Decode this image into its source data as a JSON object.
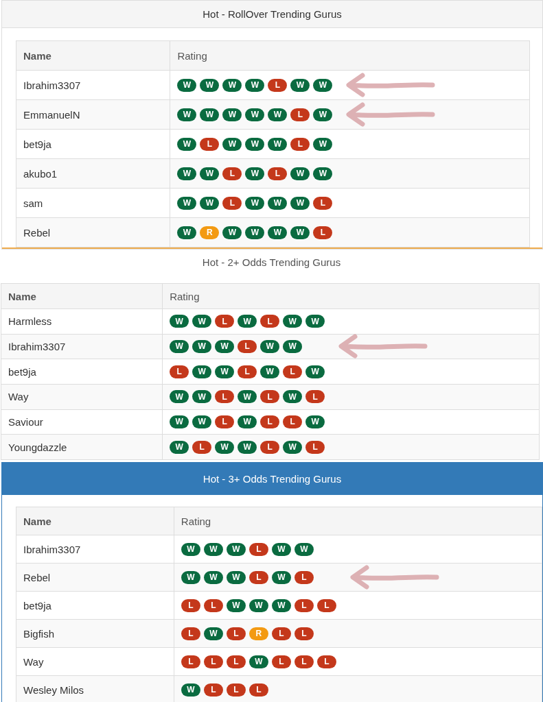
{
  "panels": [
    {
      "kind": "grey",
      "title": "Hot - RollOver Trending Gurus",
      "columns": [
        "Name",
        "Rating"
      ],
      "rows": [
        {
          "name": "Ibrahim3307",
          "annotated": true,
          "badges": [
            {
              "text": "W",
              "color": "#0a6b40"
            },
            {
              "text": "W",
              "color": "#0a6b40"
            },
            {
              "text": "W",
              "color": "#0a6b40"
            },
            {
              "text": "W",
              "color": "#0a6b40"
            },
            {
              "text": "L",
              "color": "#c4381b"
            },
            {
              "text": "W",
              "color": "#0a6b40"
            },
            {
              "text": "W",
              "color": "#0a6b40"
            }
          ]
        },
        {
          "name": "EmmanuelN",
          "annotated": true,
          "badges": [
            {
              "text": "W",
              "color": "#0a6b40"
            },
            {
              "text": "W",
              "color": "#0a6b40"
            },
            {
              "text": "W",
              "color": "#0a6b40"
            },
            {
              "text": "W",
              "color": "#0a6b40"
            },
            {
              "text": "W",
              "color": "#0a6b40"
            },
            {
              "text": "L",
              "color": "#c4381b"
            },
            {
              "text": "W",
              "color": "#0a6b40"
            }
          ]
        },
        {
          "name": "bet9ja",
          "annotated": false,
          "badges": [
            {
              "text": "W",
              "color": "#0a6b40"
            },
            {
              "text": "L",
              "color": "#c4381b"
            },
            {
              "text": "W",
              "color": "#0a6b40"
            },
            {
              "text": "W",
              "color": "#0a6b40"
            },
            {
              "text": "W",
              "color": "#0a6b40"
            },
            {
              "text": "L",
              "color": "#c4381b"
            },
            {
              "text": "W",
              "color": "#0a6b40"
            }
          ]
        },
        {
          "name": "akubo1",
          "annotated": false,
          "badges": [
            {
              "text": "W",
              "color": "#0a6b40"
            },
            {
              "text": "W",
              "color": "#0a6b40"
            },
            {
              "text": "L",
              "color": "#c4381b"
            },
            {
              "text": "W",
              "color": "#0a6b40"
            },
            {
              "text": "L",
              "color": "#c4381b"
            },
            {
              "text": "W",
              "color": "#0a6b40"
            },
            {
              "text": "W",
              "color": "#0a6b40"
            }
          ]
        },
        {
          "name": "sam",
          "annotated": false,
          "badges": [
            {
              "text": "W",
              "color": "#0a6b40"
            },
            {
              "text": "W",
              "color": "#0a6b40"
            },
            {
              "text": "L",
              "color": "#c4381b"
            },
            {
              "text": "W",
              "color": "#0a6b40"
            },
            {
              "text": "W",
              "color": "#0a6b40"
            },
            {
              "text": "W",
              "color": "#0a6b40"
            },
            {
              "text": "L",
              "color": "#c4381b"
            }
          ]
        },
        {
          "name": "Rebel",
          "annotated": false,
          "badges": [
            {
              "text": "W",
              "color": "#0a6b40"
            },
            {
              "text": "R",
              "color": "#f39a12"
            },
            {
              "text": "W",
              "color": "#0a6b40"
            },
            {
              "text": "W",
              "color": "#0a6b40"
            },
            {
              "text": "W",
              "color": "#0a6b40"
            },
            {
              "text": "W",
              "color": "#0a6b40"
            },
            {
              "text": "L",
              "color": "#c4381b"
            }
          ]
        }
      ]
    },
    {
      "kind": "plain",
      "title": "Hot - 2+ Odds Trending Gurus",
      "columns": [
        "Name",
        "Rating"
      ],
      "rows": [
        {
          "name": "Harmless",
          "annotated": false,
          "badges": [
            {
              "text": "W",
              "color": "#0a6b40"
            },
            {
              "text": "W",
              "color": "#0a6b40"
            },
            {
              "text": "L",
              "color": "#c4381b"
            },
            {
              "text": "W",
              "color": "#0a6b40"
            },
            {
              "text": "L",
              "color": "#c4381b"
            },
            {
              "text": "W",
              "color": "#0a6b40"
            },
            {
              "text": "W",
              "color": "#0a6b40"
            }
          ]
        },
        {
          "name": "Ibrahim3307",
          "annotated": true,
          "badges": [
            {
              "text": "W",
              "color": "#0a6b40"
            },
            {
              "text": "W",
              "color": "#0a6b40"
            },
            {
              "text": "W",
              "color": "#0a6b40"
            },
            {
              "text": "L",
              "color": "#c4381b"
            },
            {
              "text": "W",
              "color": "#0a6b40"
            },
            {
              "text": "W",
              "color": "#0a6b40"
            }
          ]
        },
        {
          "name": "bet9ja",
          "annotated": false,
          "badges": [
            {
              "text": "L",
              "color": "#c4381b"
            },
            {
              "text": "W",
              "color": "#0a6b40"
            },
            {
              "text": "W",
              "color": "#0a6b40"
            },
            {
              "text": "L",
              "color": "#c4381b"
            },
            {
              "text": "W",
              "color": "#0a6b40"
            },
            {
              "text": "L",
              "color": "#c4381b"
            },
            {
              "text": "W",
              "color": "#0a6b40"
            }
          ]
        },
        {
          "name": "Way",
          "annotated": false,
          "badges": [
            {
              "text": "W",
              "color": "#0a6b40"
            },
            {
              "text": "W",
              "color": "#0a6b40"
            },
            {
              "text": "L",
              "color": "#c4381b"
            },
            {
              "text": "W",
              "color": "#0a6b40"
            },
            {
              "text": "L",
              "color": "#c4381b"
            },
            {
              "text": "W",
              "color": "#0a6b40"
            },
            {
              "text": "L",
              "color": "#c4381b"
            }
          ]
        },
        {
          "name": "Saviour",
          "annotated": false,
          "badges": [
            {
              "text": "W",
              "color": "#0a6b40"
            },
            {
              "text": "W",
              "color": "#0a6b40"
            },
            {
              "text": "L",
              "color": "#c4381b"
            },
            {
              "text": "W",
              "color": "#0a6b40"
            },
            {
              "text": "L",
              "color": "#c4381b"
            },
            {
              "text": "L",
              "color": "#c4381b"
            },
            {
              "text": "W",
              "color": "#0a6b40"
            }
          ]
        },
        {
          "name": "Youngdazzle",
          "annotated": false,
          "badges": [
            {
              "text": "W",
              "color": "#0a6b40"
            },
            {
              "text": "L",
              "color": "#c4381b"
            },
            {
              "text": "W",
              "color": "#0a6b40"
            },
            {
              "text": "W",
              "color": "#0a6b40"
            },
            {
              "text": "L",
              "color": "#c4381b"
            },
            {
              "text": "W",
              "color": "#0a6b40"
            },
            {
              "text": "L",
              "color": "#c4381b"
            }
          ]
        }
      ]
    },
    {
      "kind": "blue",
      "title": "Hot - 3+ Odds Trending Gurus",
      "columns": [
        "Name",
        "Rating"
      ],
      "rows": [
        {
          "name": "Ibrahim3307",
          "annotated": false,
          "badges": [
            {
              "text": "W",
              "color": "#0a6b40"
            },
            {
              "text": "W",
              "color": "#0a6b40"
            },
            {
              "text": "W",
              "color": "#0a6b40"
            },
            {
              "text": "L",
              "color": "#c4381b"
            },
            {
              "text": "W",
              "color": "#0a6b40"
            },
            {
              "text": "W",
              "color": "#0a6b40"
            }
          ]
        },
        {
          "name": "Rebel",
          "annotated": true,
          "badges": [
            {
              "text": "W",
              "color": "#0a6b40"
            },
            {
              "text": "W",
              "color": "#0a6b40"
            },
            {
              "text": "W",
              "color": "#0a6b40"
            },
            {
              "text": "L",
              "color": "#c4381b"
            },
            {
              "text": "W",
              "color": "#0a6b40"
            },
            {
              "text": "L",
              "color": "#c4381b"
            }
          ]
        },
        {
          "name": "bet9ja",
          "annotated": false,
          "badges": [
            {
              "text": "L",
              "color": "#c4381b"
            },
            {
              "text": "L",
              "color": "#c4381b"
            },
            {
              "text": "W",
              "color": "#0a6b40"
            },
            {
              "text": "W",
              "color": "#0a6b40"
            },
            {
              "text": "W",
              "color": "#0a6b40"
            },
            {
              "text": "L",
              "color": "#c4381b"
            },
            {
              "text": "L",
              "color": "#c4381b"
            }
          ]
        },
        {
          "name": "Bigfish",
          "annotated": false,
          "badges": [
            {
              "text": "L",
              "color": "#c4381b"
            },
            {
              "text": "W",
              "color": "#0a6b40"
            },
            {
              "text": "L",
              "color": "#c4381b"
            },
            {
              "text": "R",
              "color": "#f39a12"
            },
            {
              "text": "L",
              "color": "#c4381b"
            },
            {
              "text": "L",
              "color": "#c4381b"
            }
          ]
        },
        {
          "name": "Way",
          "annotated": false,
          "badges": [
            {
              "text": "L",
              "color": "#c4381b"
            },
            {
              "text": "L",
              "color": "#c4381b"
            },
            {
              "text": "L",
              "color": "#c4381b"
            },
            {
              "text": "W",
              "color": "#0a6b40"
            },
            {
              "text": "L",
              "color": "#c4381b"
            },
            {
              "text": "L",
              "color": "#c4381b"
            },
            {
              "text": "L",
              "color": "#c4381b"
            }
          ]
        },
        {
          "name": "Wesley Milos",
          "annotated": false,
          "badges": [
            {
              "text": "W",
              "color": "#0a6b40"
            },
            {
              "text": "L",
              "color": "#c4381b"
            },
            {
              "text": "L",
              "color": "#c4381b"
            },
            {
              "text": "L",
              "color": "#c4381b"
            }
          ]
        }
      ]
    }
  ]
}
